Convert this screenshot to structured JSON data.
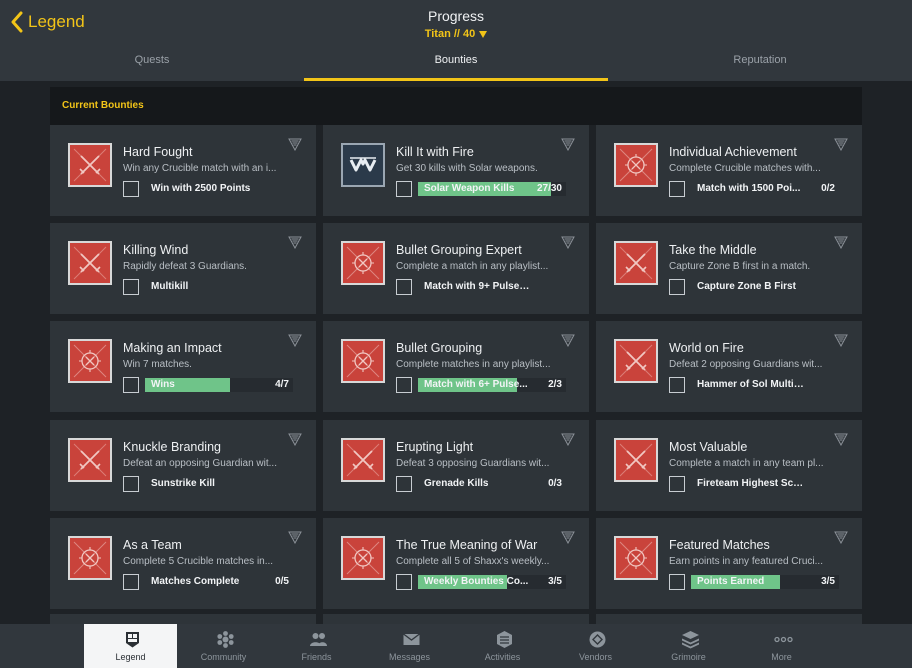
{
  "header": {
    "back_label": "Legend",
    "title": "Progress",
    "subtitle": "Titan // 40"
  },
  "tabs": [
    {
      "label": "Quests"
    },
    {
      "label": "Bounties"
    },
    {
      "label": "Reputation"
    }
  ],
  "section": {
    "title": "Current Bounties"
  },
  "bounties": [
    {
      "title": "Hard Fought",
      "description": "Win any Crucible match with an i...",
      "objective": "Win with 2500 Points",
      "progress": "",
      "fill": 0,
      "icon": "crossed-swords-icon"
    },
    {
      "title": "Kill It with Fire",
      "description": "Get 30 kills with Solar weapons.",
      "objective": "Solar Weapon Kills",
      "progress": "27/30",
      "fill": 0.9,
      "icon": "weapon-emblem-icon"
    },
    {
      "title": "Individual Achievement",
      "description": "Complete Crucible matches with...",
      "objective": "Match with 1500 Poi...",
      "progress": "0/2",
      "fill": 0,
      "icon": "crucible-crest-icon"
    },
    {
      "title": "Killing Wind",
      "description": "Rapidly defeat 3 Guardians.",
      "objective": "Multikill",
      "progress": "",
      "fill": 0,
      "icon": "crossed-swords-icon"
    },
    {
      "title": "Bullet Grouping Expert",
      "description": "Complete a match in any playlist...",
      "objective": "Match with 9+ Pulse Rif...",
      "progress": "",
      "fill": 0,
      "icon": "crucible-crest-icon"
    },
    {
      "title": "Take the Middle",
      "description": "Capture Zone B first in a match.",
      "objective": "Capture Zone B First",
      "progress": "",
      "fill": 0,
      "icon": "crossed-swords-icon"
    },
    {
      "title": "Making an Impact",
      "description": "Win 7 matches.",
      "objective": "Wins",
      "progress": "4/7",
      "fill": 0.571,
      "icon": "crucible-crest-icon"
    },
    {
      "title": "Bullet Grouping",
      "description": "Complete matches in any playlist...",
      "objective": "Match with 6+ Pulse...",
      "progress": "2/3",
      "fill": 0.667,
      "icon": "crucible-crest-icon"
    },
    {
      "title": "World on Fire",
      "description": "Defeat 2 opposing Guardians wit...",
      "objective": "Hammer of Sol Multikill",
      "progress": "",
      "fill": 0,
      "icon": "crossed-swords-icon"
    },
    {
      "title": "Knuckle Branding",
      "description": "Defeat an opposing Guardian wit...",
      "objective": "Sunstrike Kill",
      "progress": "",
      "fill": 0,
      "icon": "crossed-swords-icon"
    },
    {
      "title": "Erupting Light",
      "description": "Defeat 3 opposing Guardians wit...",
      "objective": "Grenade Kills",
      "progress": "0/3",
      "fill": 0,
      "icon": "crossed-swords-icon"
    },
    {
      "title": "Most Valuable",
      "description": "Complete a match in any team pl...",
      "objective": "Fireteam Highest Score",
      "progress": "",
      "fill": 0,
      "icon": "crossed-swords-icon"
    },
    {
      "title": "As a Team",
      "description": "Complete 5 Crucible matches in...",
      "objective": "Matches Complete",
      "progress": "0/5",
      "fill": 0,
      "icon": "crucible-crest-icon"
    },
    {
      "title": "The True Meaning of War",
      "description": "Complete all 5 of Shaxx's weekly...",
      "objective": "Weekly Bounties Co...",
      "progress": "3/5",
      "fill": 0.6,
      "icon": "crucible-crest-icon"
    },
    {
      "title": "Featured Matches",
      "description": "Earn points in any featured Cruci...",
      "objective": "Points Earned",
      "progress": "3/5",
      "fill": 0.6,
      "icon": "crucible-crest-icon"
    }
  ],
  "nav": [
    {
      "label": "Legend",
      "icon": "legend-icon"
    },
    {
      "label": "Community",
      "icon": "community-icon"
    },
    {
      "label": "Friends",
      "icon": "friends-icon"
    },
    {
      "label": "Messages",
      "icon": "messages-icon"
    },
    {
      "label": "Activities",
      "icon": "activities-icon"
    },
    {
      "label": "Vendors",
      "icon": "vendors-icon"
    },
    {
      "label": "Grimoire",
      "icon": "grimoire-icon"
    },
    {
      "label": "More",
      "icon": "more-icon"
    }
  ],
  "colors": {
    "accent": "#f2c418",
    "progress": "#6fc489",
    "bounty_icon": "#c9433b"
  }
}
